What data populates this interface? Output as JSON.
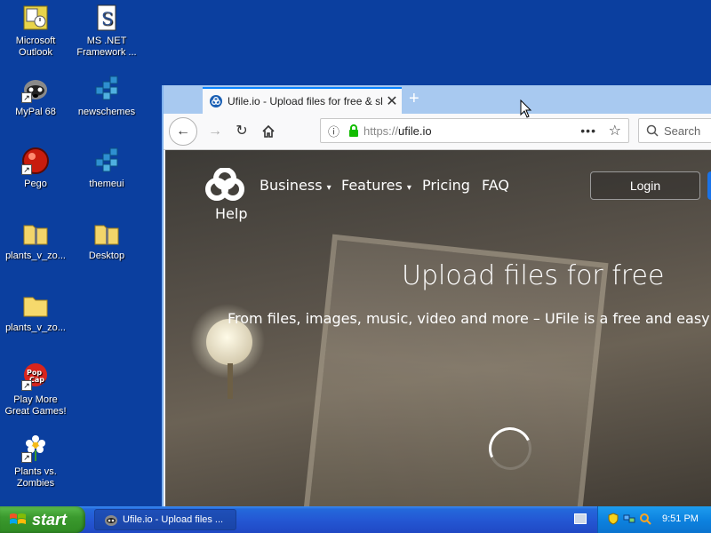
{
  "desktop": {
    "icons": [
      {
        "label_line1": "Microsoft",
        "label_line2": "Outlook",
        "icon": "outlook-icon"
      },
      {
        "label_line1": "MS .NET",
        "label_line2": "Framework ...",
        "icon": "dotnet-icon"
      },
      {
        "label_line1": "MyPal 68",
        "label_line2": "",
        "icon": "mypal-icon"
      },
      {
        "label_line1": "newschemes",
        "label_line2": "",
        "icon": "registry-file-icon"
      },
      {
        "label_line1": "Pego",
        "label_line2": "",
        "icon": "pego-icon"
      },
      {
        "label_line1": "themeui",
        "label_line2": "",
        "icon": "registry-file-icon"
      },
      {
        "label_line1": "plants_v_zo...",
        "label_line2": "",
        "icon": "zip-folder-icon"
      },
      {
        "label_line1": "Desktop",
        "label_line2": "",
        "icon": "zip-folder-icon"
      },
      {
        "label_line1": "plants_v_zo...",
        "label_line2": "",
        "icon": "folder-icon"
      },
      {
        "label_line1": "Play More",
        "label_line2": "Great Games!",
        "icon": "popcap-icon"
      },
      {
        "label_line1": "Plants vs.",
        "label_line2": "Zombies",
        "icon": "plants-vs-zombies-icon"
      }
    ]
  },
  "browser": {
    "tab": {
      "title": "Ufile.io - Upload files for free & sh"
    },
    "new_tab_glyph": "+",
    "url": {
      "protocol": "https://",
      "host": "ufile.io"
    },
    "search_placeholder": "Search"
  },
  "page": {
    "nav": {
      "business": "Business",
      "features": "Features",
      "pricing": "Pricing",
      "faq": "FAQ",
      "help": "Help",
      "login": "Login"
    },
    "hero": {
      "title": "Upload files for free",
      "subtitle": "From files, images, music, video and more – UFile is a free and easy way to sh"
    },
    "colors": {
      "accent": "#1a73e8"
    }
  },
  "taskbar": {
    "start_label": "start",
    "task_button_label": "Ufile.io - Upload files ...",
    "clock": "9:51 PM"
  }
}
